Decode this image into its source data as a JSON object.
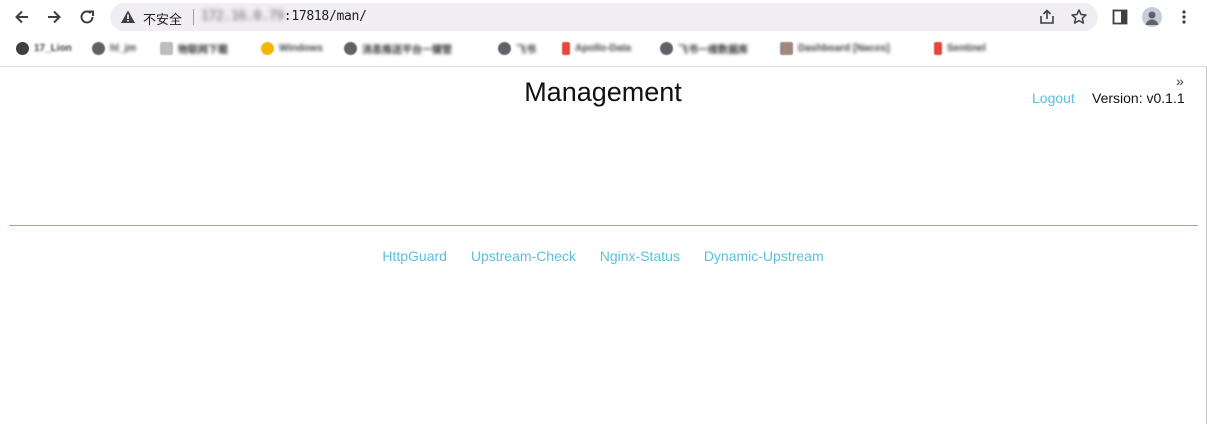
{
  "browser": {
    "address": {
      "security_label": "不安全",
      "url_visible_prefix": "172.16.0.79",
      "url_port_path": ":17818/man/"
    },
    "bookmarks": [
      {
        "label": "17_Lion"
      },
      {
        "label": "hl_jm"
      },
      {
        "label": "物联网下载"
      },
      {
        "label": "Windows"
      },
      {
        "label": "消息推送平台一键管"
      },
      {
        "label": "飞书"
      },
      {
        "label": "Apollo-Data"
      },
      {
        "label": "飞书一维数据库"
      },
      {
        "label": "Dashboard [Nacos]"
      },
      {
        "label": "Sentinel"
      }
    ],
    "overflow_label": "»"
  },
  "page": {
    "title": "Management",
    "logout_label": "Logout",
    "version_label": "Version: v0.1.1",
    "nav_links": [
      {
        "label": "HttpGuard"
      },
      {
        "label": "Upstream-Check"
      },
      {
        "label": "Nginx-Status"
      },
      {
        "label": "Dynamic-Upstream"
      }
    ]
  },
  "colors": {
    "link": "#5bc0de",
    "omnibox_bg": "#f1eef3"
  }
}
